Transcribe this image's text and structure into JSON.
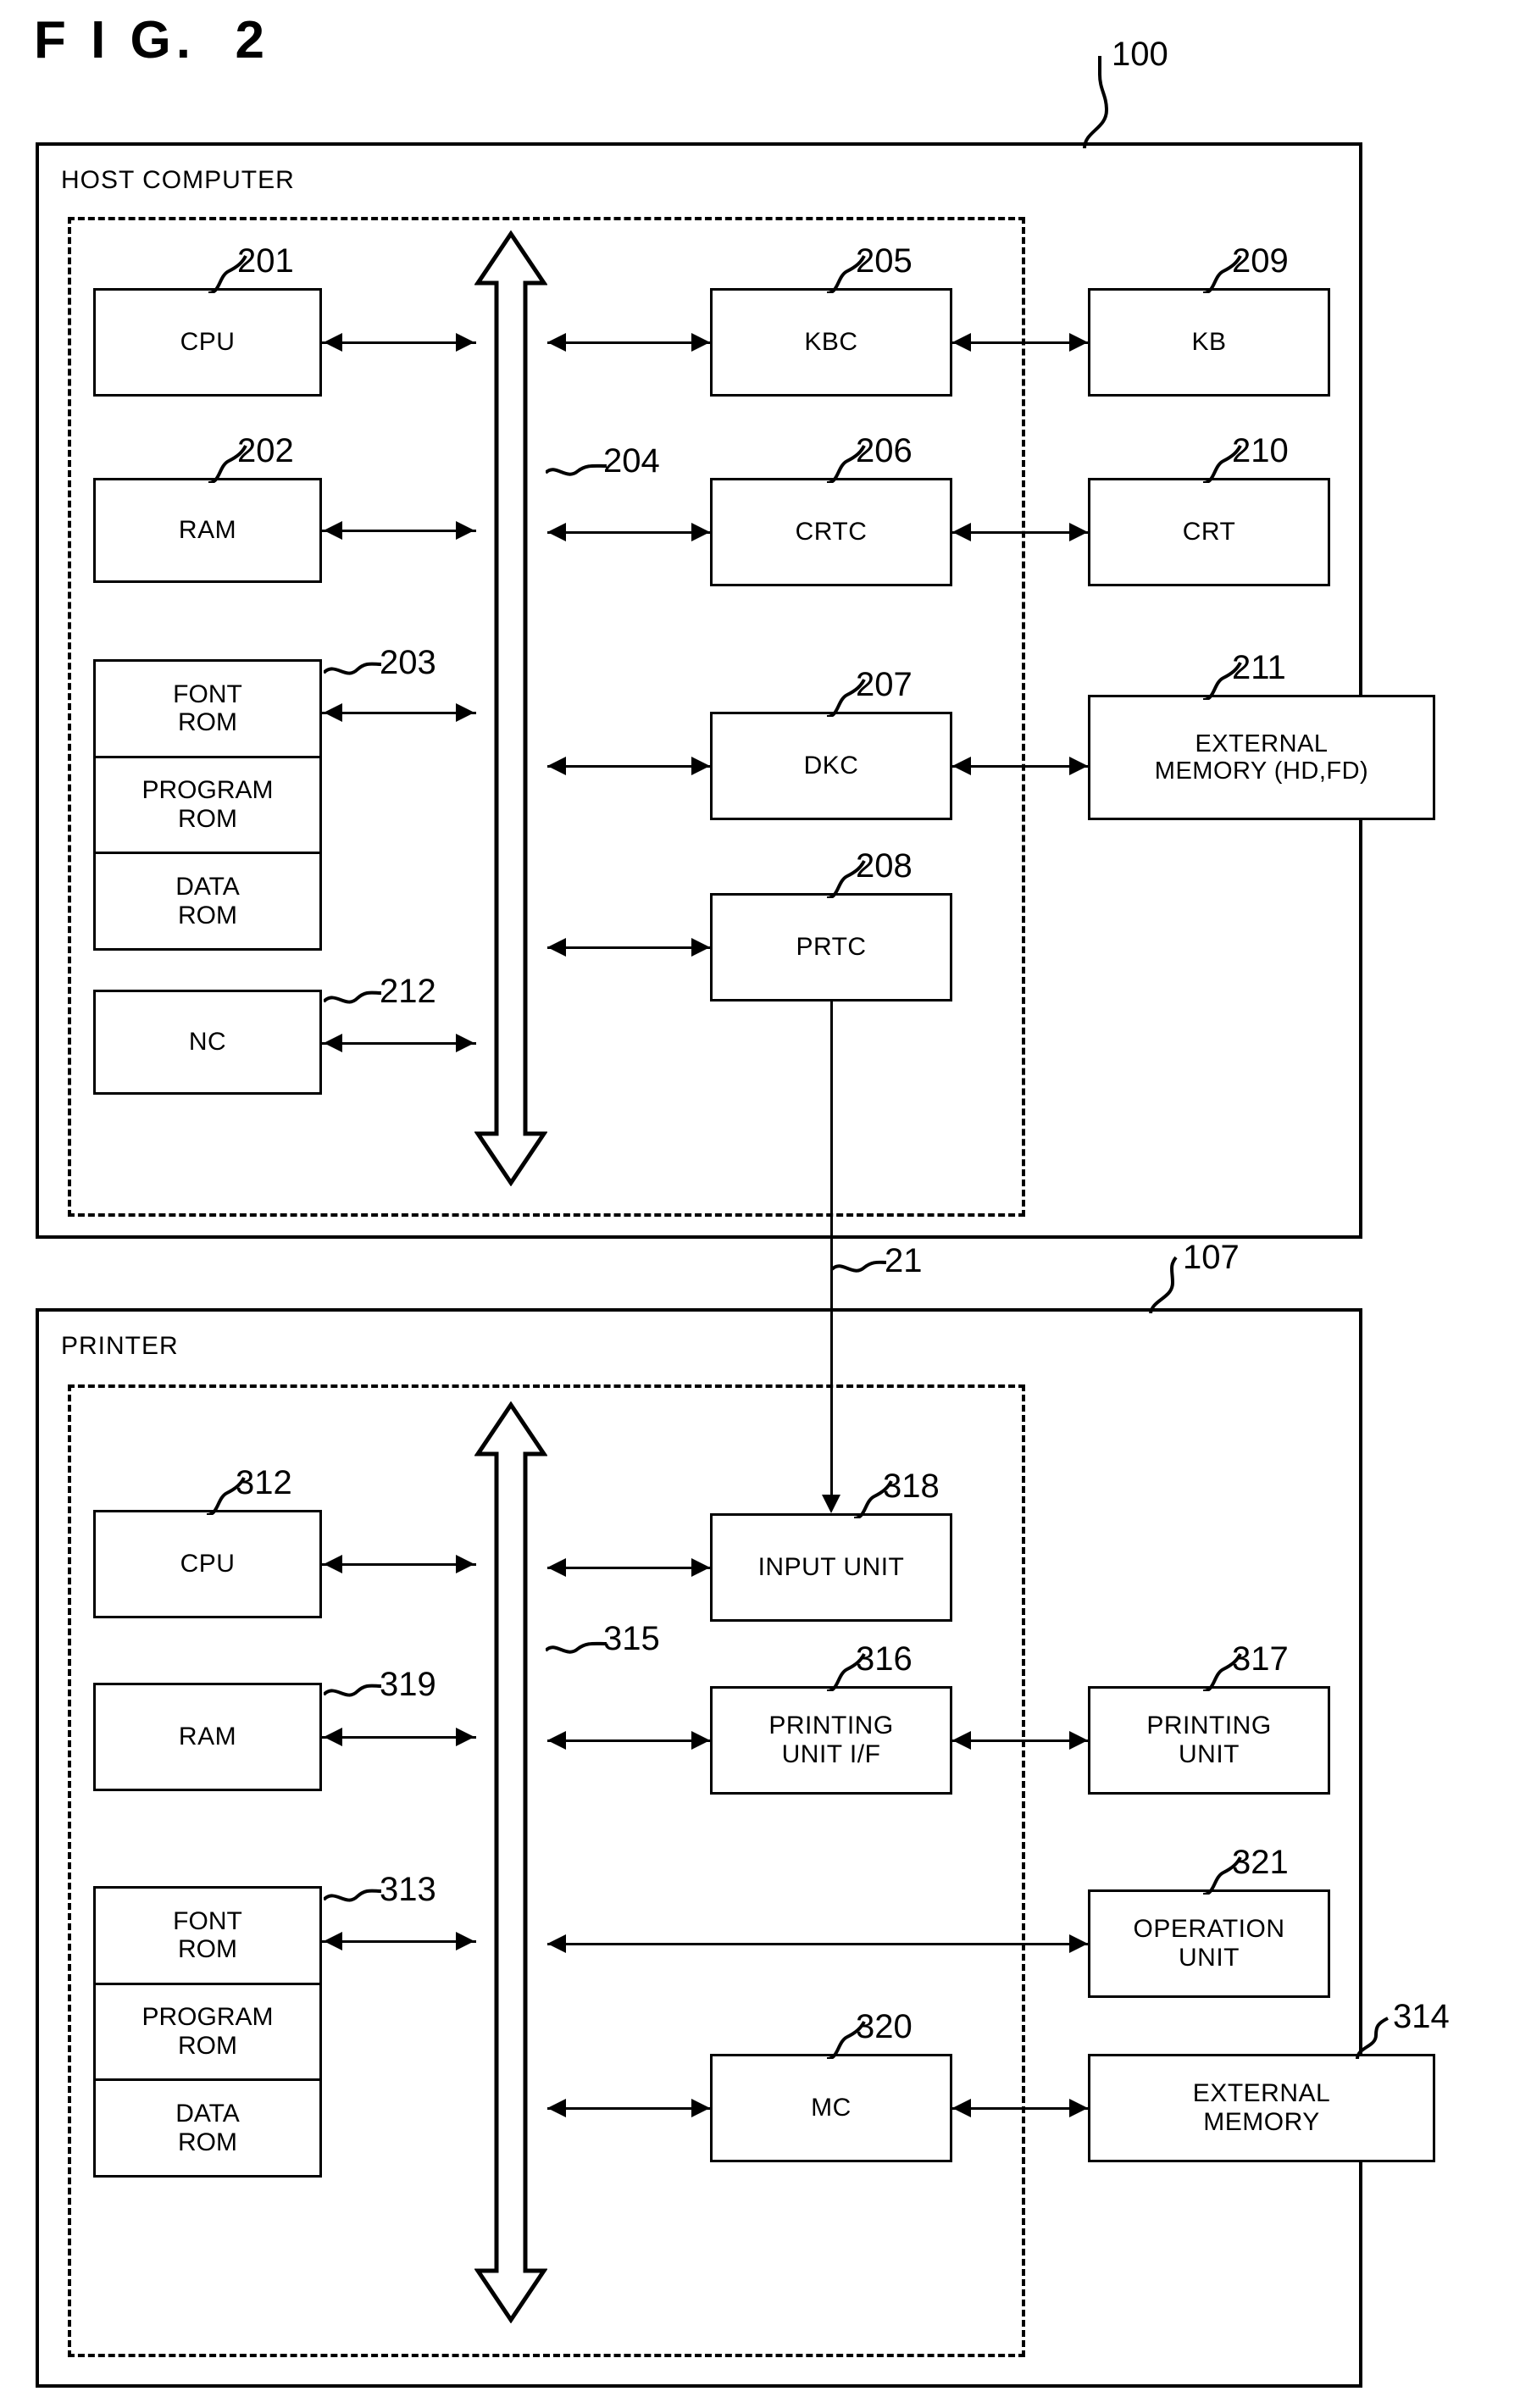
{
  "figure": {
    "title": "F I G.  2"
  },
  "sections": [
    {
      "id": "host",
      "caption": "HOST COMPUTER",
      "ref": "100"
    },
    {
      "id": "printer",
      "caption": "PRINTER",
      "ref": "107"
    }
  ],
  "host": {
    "caption": "HOST COMPUTER",
    "ref": "100",
    "bus_ref": "204",
    "units": [
      {
        "ref": "201",
        "label": "CPU"
      },
      {
        "ref": "202",
        "label": "RAM"
      },
      {
        "ref": "203",
        "label": "ROM",
        "cells": [
          "FONT\nROM",
          "PROGRAM\nROM",
          "DATA\nROM"
        ]
      },
      {
        "ref": "212",
        "label": "NC"
      },
      {
        "ref": "205",
        "label": "KBC"
      },
      {
        "ref": "206",
        "label": "CRTC"
      },
      {
        "ref": "207",
        "label": "DKC"
      },
      {
        "ref": "208",
        "label": "PRTC"
      },
      {
        "ref": "209",
        "label": "KB"
      },
      {
        "ref": "210",
        "label": "CRT"
      },
      {
        "ref": "211",
        "label": "EXTERNAL\nMEMORY (HD,FD)"
      }
    ],
    "unit_labels": {
      "cpu": "CPU",
      "ram": "RAM",
      "font_rom": "FONT\nROM",
      "program_rom": "PROGRAM\nROM",
      "data_rom": "DATA\nROM",
      "nc": "NC",
      "kbc": "KBC",
      "crtc": "CRTC",
      "dkc": "DKC",
      "prtc": "PRTC",
      "kb": "KB",
      "crt": "CRT",
      "external_memory": "EXTERNAL\nMEMORY (HD,FD)"
    },
    "refs": {
      "cpu": "201",
      "ram": "202",
      "rom": "203",
      "bus": "204",
      "kbc": "205",
      "crtc": "206",
      "dkc": "207",
      "prtc": "208",
      "kb": "209",
      "crt": "210",
      "external_memory": "211",
      "nc": "212",
      "enclosure": "100"
    }
  },
  "printer": {
    "caption": "PRINTER",
    "ref": "107",
    "bus_ref": "315",
    "unit_labels": {
      "cpu": "CPU",
      "ram": "RAM",
      "font_rom": "FONT\nROM",
      "program_rom": "PROGRAM\nROM",
      "data_rom": "DATA\nROM",
      "input_unit": "INPUT UNIT",
      "printing_unit_if": "PRINTING\nUNIT I/F",
      "printing_unit": "PRINTING\nUNIT",
      "operation_unit": "OPERATION\nUNIT",
      "mc": "MC",
      "external_memory": "EXTERNAL\nMEMORY"
    },
    "refs": {
      "cpu": "312",
      "ram": "319",
      "rom": "313",
      "bus": "315",
      "printing_unit_if": "316",
      "printing_unit": "317",
      "input_unit": "318",
      "mc": "320",
      "operation_unit": "321",
      "external_memory": "314",
      "enclosure": "107"
    }
  },
  "interface": {
    "ref": "21"
  },
  "colors": {
    "ink": "#000000",
    "paper": "#ffffff"
  }
}
